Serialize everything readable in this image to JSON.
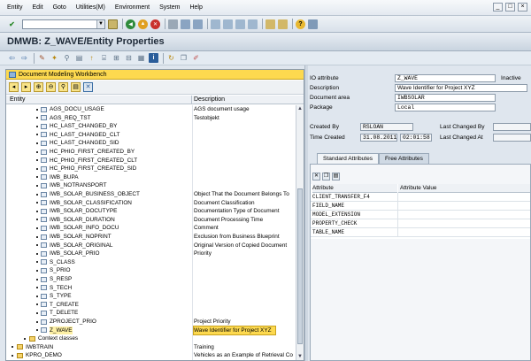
{
  "menubar": {
    "items": [
      "Entity",
      "Edit",
      "Goto",
      "Utilities(M)",
      "Environment",
      "System",
      "Help"
    ]
  },
  "title": "DMWB: Z_WAVE/Entity Properties",
  "left_pane": {
    "title": "Document Modeling Workbench",
    "col_entity": "Entity",
    "col_description": "Description",
    "rows": [
      {
        "name": "AGS_DOCU_USAGE",
        "desc": "AGS document usage"
      },
      {
        "name": "AGS_REQ_TST",
        "desc": "Testobjekt"
      },
      {
        "name": "HC_LAST_CHANGED_BY",
        "desc": ""
      },
      {
        "name": "HC_LAST_CHANGED_CLT",
        "desc": ""
      },
      {
        "name": "HC_LAST_CHANGED_SID",
        "desc": ""
      },
      {
        "name": "HC_PHIO_FIRST_CREATED_BY",
        "desc": ""
      },
      {
        "name": "HC_PHIO_FIRST_CREATED_CLT",
        "desc": ""
      },
      {
        "name": "HC_PHIO_FIRST_CREATED_SID",
        "desc": ""
      },
      {
        "name": "IWB_BUPA",
        "desc": ""
      },
      {
        "name": "IWB_NOTRANSPORT",
        "desc": ""
      },
      {
        "name": "IWB_SOLAR_BUSINESS_OBJECT",
        "desc": "Object That the Document Belongs To"
      },
      {
        "name": "IWB_SOLAR_CLASSIFICATION",
        "desc": "Document Classification"
      },
      {
        "name": "IWB_SOLAR_DOCUTYPE",
        "desc": "Documentation Type of Document"
      },
      {
        "name": "IWB_SOLAR_DURATION",
        "desc": "Document Processing Time"
      },
      {
        "name": "IWB_SOLAR_INFO_DOCU",
        "desc": "Comment"
      },
      {
        "name": "IWB_SOLAR_NOPRINT",
        "desc": "Exclusion from Business Blueprint"
      },
      {
        "name": "IWB_SOLAR_ORIGINAL",
        "desc": "Original Version of Copied Document"
      },
      {
        "name": "IWB_SOLAR_PRIO",
        "desc": "Priority"
      },
      {
        "name": "S_CLASS",
        "desc": ""
      },
      {
        "name": "S_PRIO",
        "desc": ""
      },
      {
        "name": "S_RESP",
        "desc": ""
      },
      {
        "name": "S_TECH",
        "desc": ""
      },
      {
        "name": "S_TYPE",
        "desc": ""
      },
      {
        "name": "T_CREATE",
        "desc": ""
      },
      {
        "name": "T_DELETE",
        "desc": ""
      },
      {
        "name": "ZPROJECT_PRIO",
        "desc": "Project Priority"
      },
      {
        "name": "Z_WAVE",
        "desc": "Wave Identifier for Project XYZ"
      },
      {
        "name": "Context classes",
        "desc": ""
      },
      {
        "name": "IWBTRAIN",
        "desc": "Training"
      },
      {
        "name": "KPRO_DEMO",
        "desc": "Vehicles as an Example of Retrieval Co"
      }
    ]
  },
  "properties": {
    "io_attribute_label": "IO attribute",
    "io_attribute_value": "Z_WAVE",
    "status": "Inactive",
    "description_label": "Description",
    "description_value": "Wave Identifier for Project XYZ",
    "document_area_label": "Document area",
    "document_area_value": "IWBSOLAR",
    "package_label": "Package",
    "package_value": "Local",
    "created_by_label": "Created By",
    "created_by_value": "RSLOAN",
    "last_changed_by_label": "Last Changed By",
    "time_created_label": "Time Created",
    "created_date": "31.08.2011",
    "created_time": "02:01:58",
    "last_changed_at_label": "Last Changed At"
  },
  "tabs": [
    "Standard Attributes",
    "Free Attributes"
  ],
  "attr_table": {
    "col_attribute": "Attribute",
    "col_value": "Attribute Value",
    "rows": [
      "CLIENT_TRANSFER_F4",
      "FIELD_NAME",
      "MODEL_EXTENSION",
      "PROPERTY_CHECK",
      "TABLE_NAME"
    ]
  }
}
